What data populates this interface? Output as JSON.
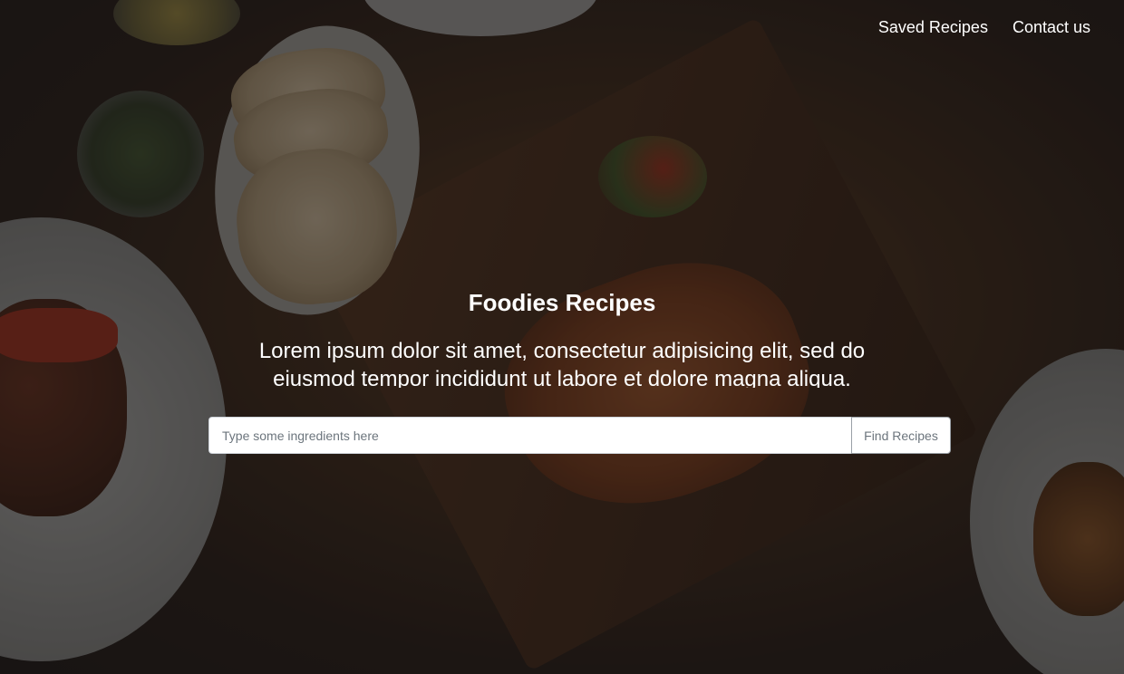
{
  "nav": {
    "items": [
      {
        "label": "Saved Recipes"
      },
      {
        "label": "Contact us"
      }
    ]
  },
  "hero": {
    "title": "Foodies Recipes",
    "subtitle": "Lorem ipsum dolor sit amet, consectetur adipisicing elit, sed do eiusmod tempor incididunt ut labore et dolore magna aliqua."
  },
  "search": {
    "placeholder": "Type some ingredients here",
    "value": "",
    "button_label": "Find Recipes"
  },
  "colors": {
    "text": "#ffffff",
    "overlay": "#141212",
    "button_text": "#6c757d",
    "input_border": "#cfd4da"
  }
}
